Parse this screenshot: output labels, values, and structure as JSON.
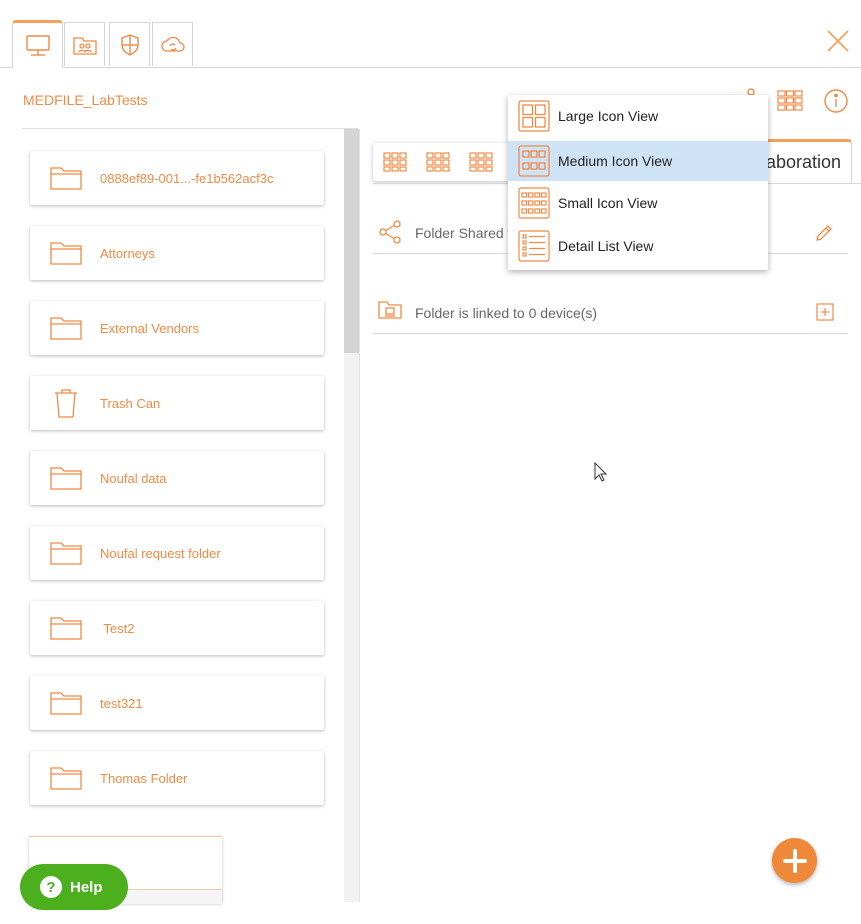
{
  "tabs": [
    {
      "name": "computer-icon",
      "active": true
    },
    {
      "name": "shared-folder-icon",
      "active": false
    },
    {
      "name": "security-shield-icon",
      "active": false
    },
    {
      "name": "cloud-sync-icon",
      "active": false
    }
  ],
  "workspace": {
    "title": "MEDFILE_LabTests"
  },
  "folders": [
    {
      "label": "0888ef89-001...-fe1b562acf3c",
      "icon": "folder-icon"
    },
    {
      "label": "Attorneys",
      "icon": "folder-icon"
    },
    {
      "label": "External Vendors",
      "icon": "folder-icon"
    },
    {
      "label": "Trash Can",
      "icon": "trash-icon"
    },
    {
      "label": "Noufal data",
      "icon": "folder-icon"
    },
    {
      "label": "Noufal request folder",
      "icon": "folder-icon"
    },
    {
      "label": " Test2",
      "icon": "folder-icon"
    },
    {
      "label": "test321",
      "icon": "folder-icon"
    },
    {
      "label": "Thomas Folder",
      "icon": "folder-icon"
    }
  ],
  "right_panel": {
    "collab_tab_label": "aboration",
    "shared_row": "Folder Shared w",
    "linked_row": "Folder is linked to 0 device(s)"
  },
  "view_menu": {
    "items": [
      {
        "label": "Large Icon View",
        "selected": false
      },
      {
        "label": "Medium Icon View",
        "selected": true
      },
      {
        "label": "Small Icon View",
        "selected": false
      },
      {
        "label": "Detail List View",
        "selected": false
      }
    ]
  },
  "help": {
    "label": "Help",
    "icon_glyph": "?"
  },
  "colors": {
    "accent": "#f08a45",
    "help_green": "#4caf1e",
    "selection": "#cfe3f7"
  }
}
